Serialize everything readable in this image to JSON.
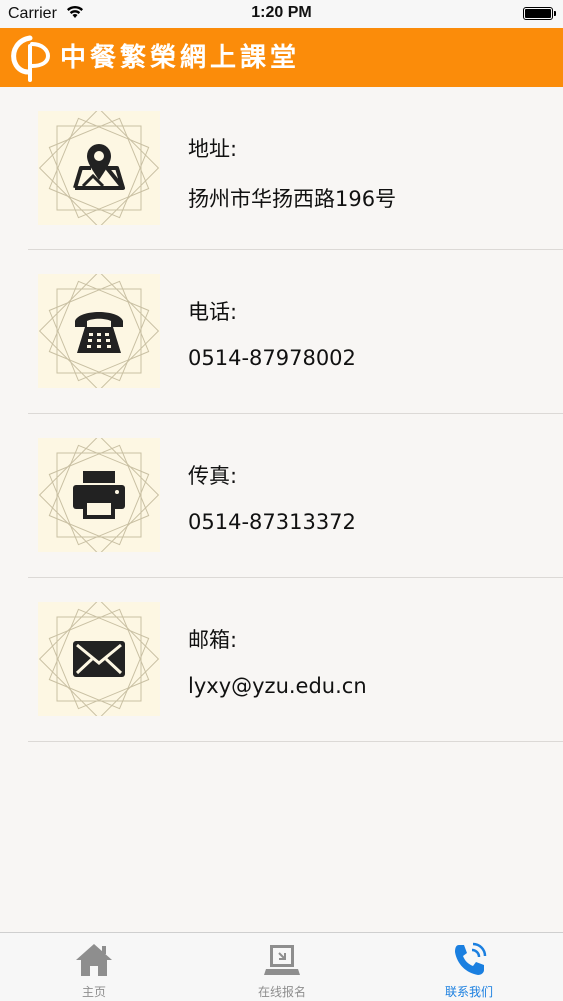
{
  "status_bar": {
    "carrier": "Carrier",
    "time": "1:20 PM"
  },
  "header": {
    "title": "中餐繁榮網上課堂"
  },
  "contacts": [
    {
      "icon": "map-pin-icon",
      "label": "地址:",
      "value": "扬州市华扬西路196号"
    },
    {
      "icon": "telephone-icon",
      "label": "电话:",
      "value": "0514-87978002"
    },
    {
      "icon": "printer-icon",
      "label": "传真:",
      "value": "0514-87313372"
    },
    {
      "icon": "envelope-icon",
      "label": "邮箱:",
      "value": "lyxy@yzu.edu.cn"
    }
  ],
  "tabs": [
    {
      "label": "主页",
      "icon": "home-icon",
      "active": false
    },
    {
      "label": "在线报名",
      "icon": "laptop-icon",
      "active": false
    },
    {
      "label": "联系我们",
      "icon": "phone-icon",
      "active": true
    }
  ],
  "colors": {
    "header": "#fb8c0a",
    "tile": "#fdf7e3",
    "active_tab": "#1a7fe0",
    "inactive_tab": "#8e8e8e"
  }
}
